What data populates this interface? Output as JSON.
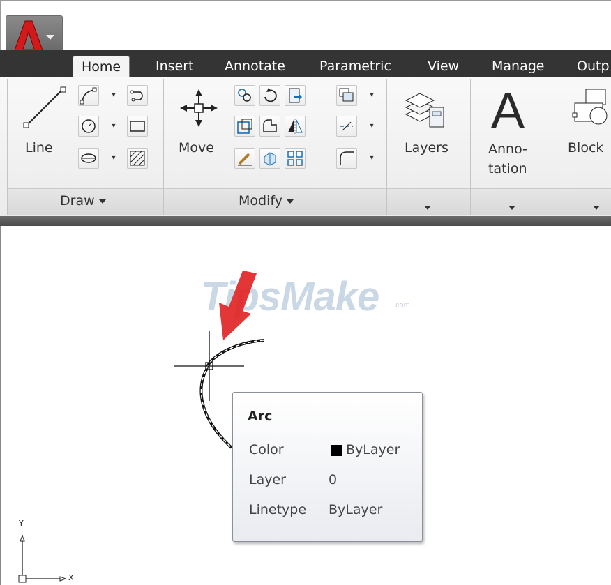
{
  "tabs": [
    "Home",
    "Insert",
    "Annotate",
    "Parametric",
    "View",
    "Manage",
    "Outp"
  ],
  "active_tab": "Home",
  "panels": {
    "draw": {
      "label": "Draw",
      "big_tool": "Line"
    },
    "modify": {
      "label": "Modify",
      "big_tool": "Move"
    },
    "layers": {
      "label": "Layers"
    },
    "annotation": {
      "label_line1": "Anno-",
      "label_line2": "tation"
    },
    "block": {
      "label": "Block"
    }
  },
  "watermark": {
    "text": "TipsMake",
    "domain": ".com"
  },
  "tooltip": {
    "title": "Arc",
    "rows": [
      {
        "key": "Color",
        "value": "ByLayer"
      },
      {
        "key": "Layer",
        "value": "0"
      },
      {
        "key": "Linetype",
        "value": "ByLayer"
      }
    ]
  },
  "ucs": {
    "x_label": "X",
    "y_label": "Y"
  },
  "colors": {
    "arrow": "#e02020",
    "tab_strip": "#343434",
    "swatch": "#000000"
  }
}
